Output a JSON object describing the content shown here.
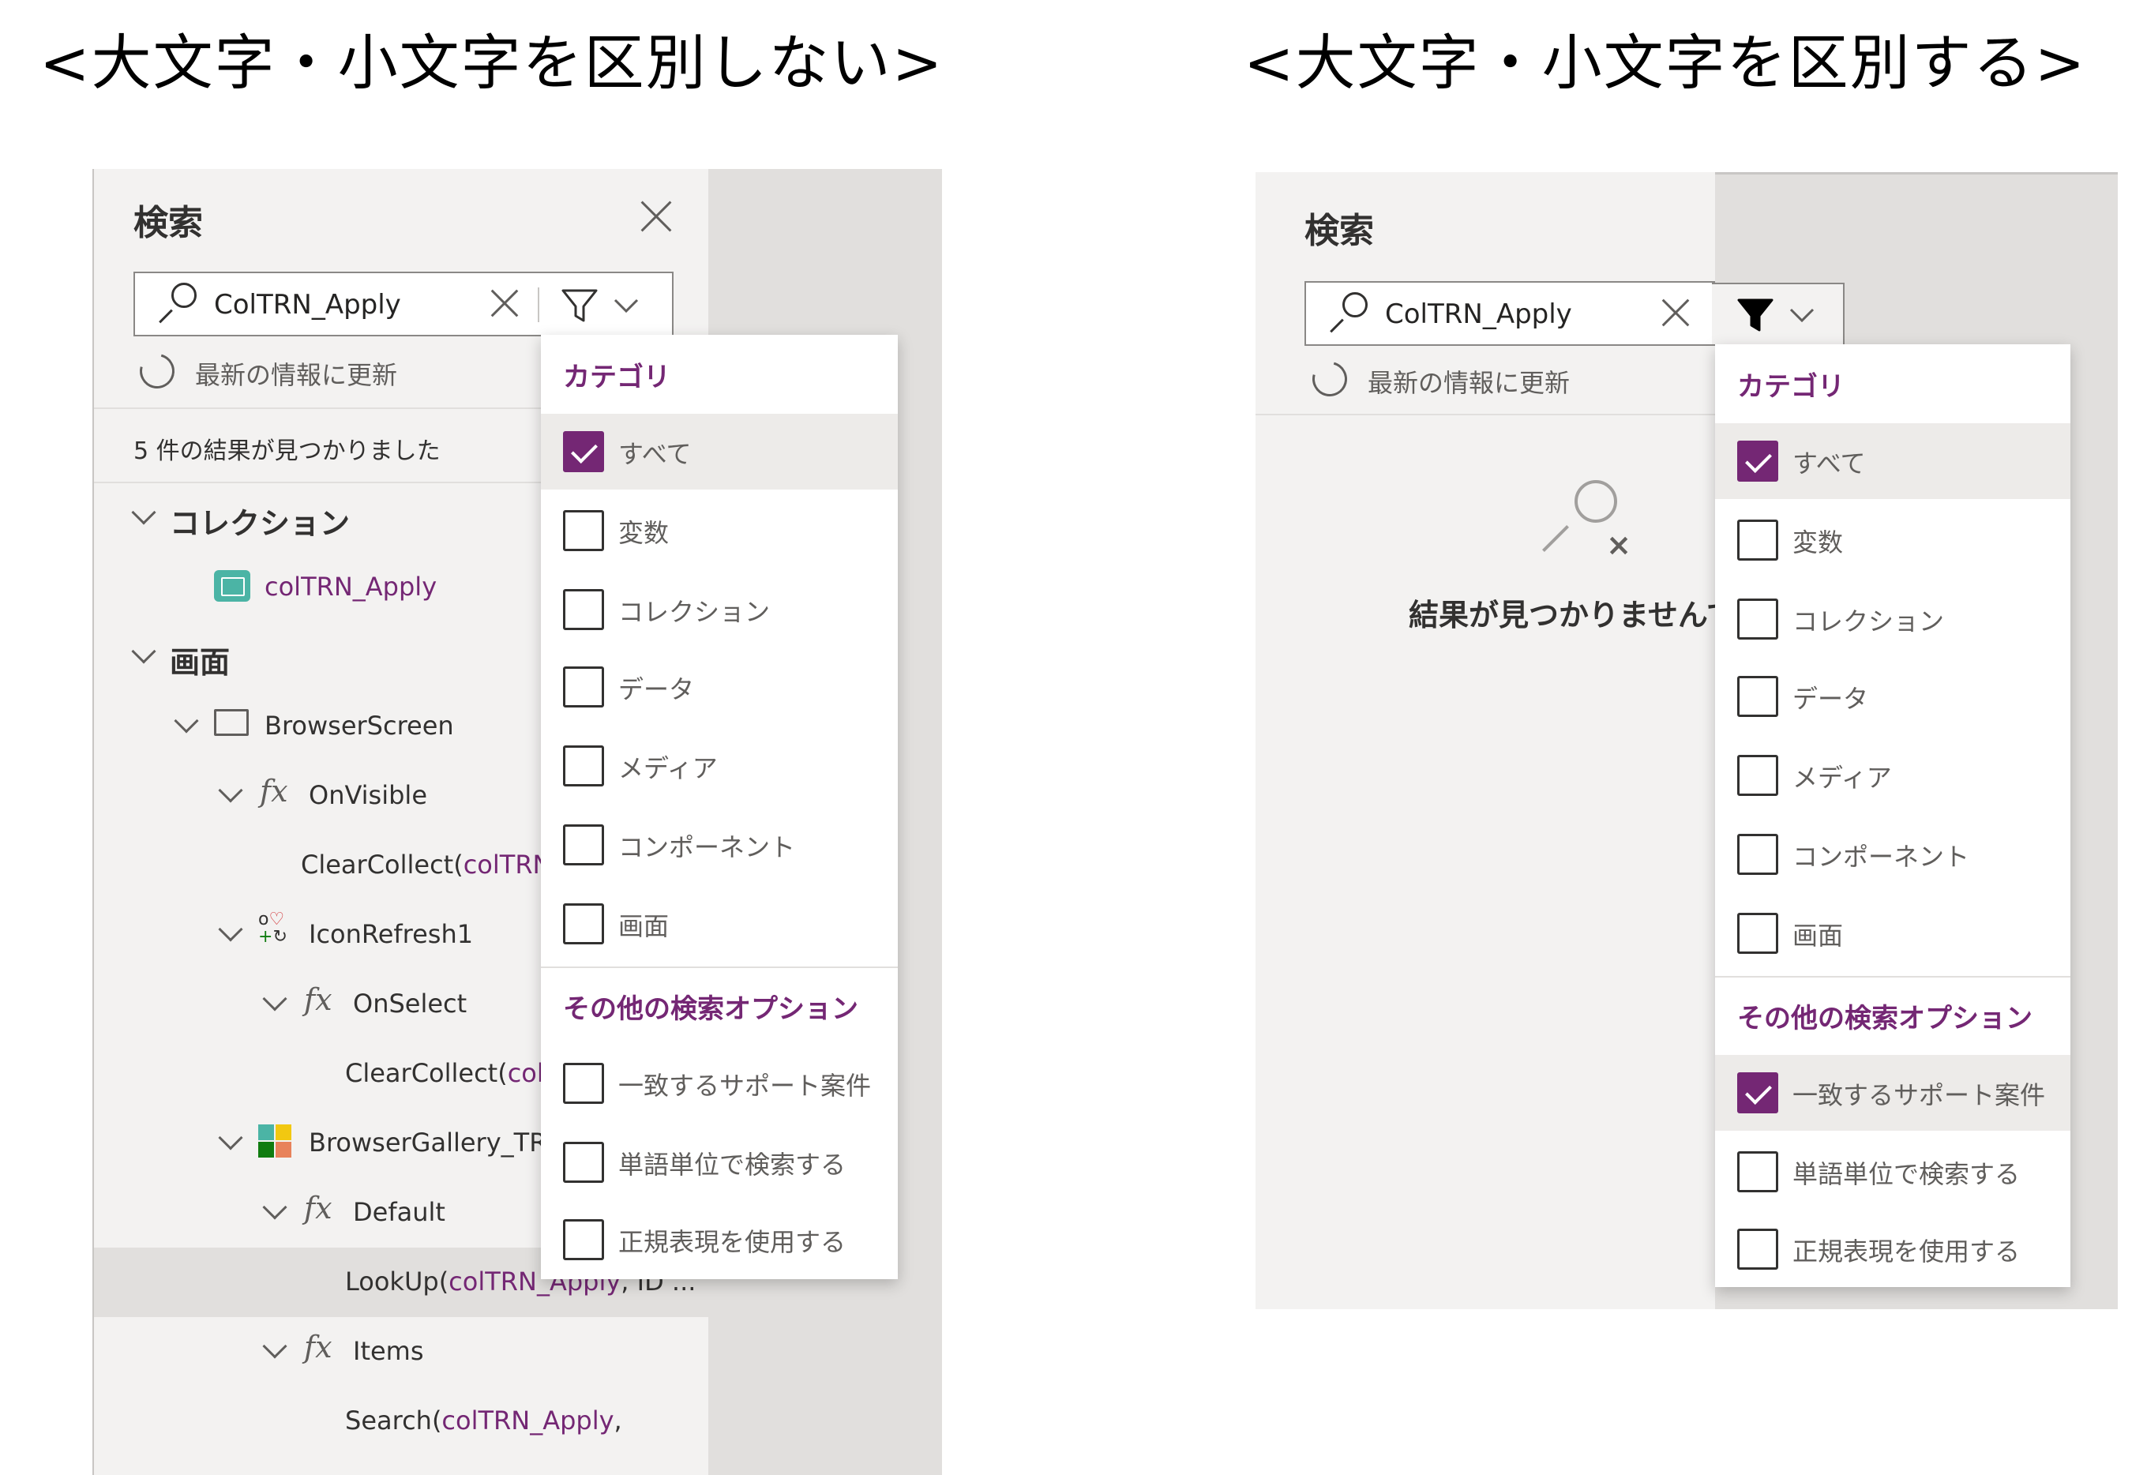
{
  "headings": {
    "left": "<大文字・小文字を区別しない>",
    "right": "<大文字・小文字を区別する>"
  },
  "panel": {
    "title": "検索",
    "search_value": "ColTRN_Apply",
    "refresh_label": "最新の情報に更新"
  },
  "left": {
    "result_count": "5 件の結果が見つかりました",
    "tree": [
      {
        "label": "コレクション",
        "purple": "",
        "tail": "",
        "icon": "chevron-down-icon"
      },
      {
        "label": "",
        "purple": "colTRN_Apply",
        "tail": "",
        "icon": "collection-icon"
      },
      {
        "label": "画面",
        "purple": "",
        "tail": "",
        "icon": "chevron-down-icon"
      },
      {
        "label": "BrowserScreen",
        "purple": "",
        "tail": "",
        "icon": "screen-icon"
      },
      {
        "label": "OnVisible",
        "purple": "",
        "tail": "",
        "icon": "fx-icon"
      },
      {
        "label": "ClearCollect(",
        "purple": "colTRN_",
        "tail": "",
        "icon": ""
      },
      {
        "label": "IconRefresh1",
        "purple": "",
        "tail": "",
        "icon": "icons-icon"
      },
      {
        "label": "OnSelect",
        "purple": "",
        "tail": "",
        "icon": "fx-icon"
      },
      {
        "label": "ClearCollect(",
        "purple": "colT",
        "tail": "",
        "icon": ""
      },
      {
        "label": "BrowserGallery_TRN",
        "purple": "",
        "tail": "",
        "icon": "gallery-icon"
      },
      {
        "label": "Default",
        "purple": "",
        "tail": "",
        "icon": "fx-icon"
      },
      {
        "label": "LookUp(",
        "purple": "colTRN_Apply",
        "tail": ", ID ...",
        "icon": ""
      },
      {
        "label": "Items",
        "purple": "",
        "tail": "",
        "icon": "fx-icon"
      },
      {
        "label": "Search(",
        "purple": "colTRN_Apply",
        "tail": ",",
        "icon": ""
      }
    ]
  },
  "right": {
    "empty_text": "結果が見つかりませんでし"
  },
  "dropdown": {
    "category_header": "カテゴリ",
    "categories": [
      "すべて",
      "変数",
      "コレクション",
      "データ",
      "メディア",
      "コンポーネント",
      "画面"
    ],
    "options_header": "その他の検索オプション",
    "options": [
      "一致するサポート案件",
      "単語単位で検索する",
      "正規表現を使用する"
    ]
  },
  "colors": {
    "accent": "#742774",
    "panel_bg": "#f3f2f1",
    "canvas_bg": "#e1dfdd"
  }
}
